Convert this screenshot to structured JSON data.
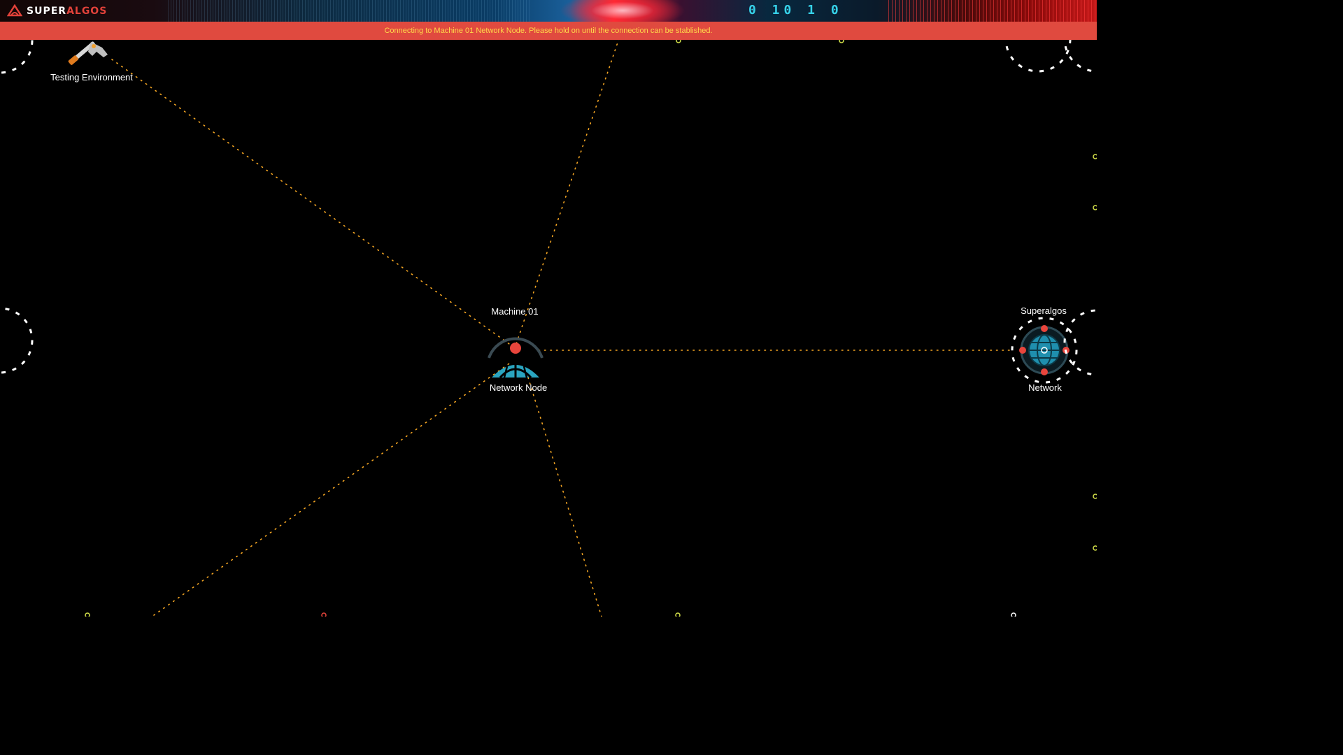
{
  "app": {
    "logo_text_primary": "SUPER",
    "logo_text_secondary": "ALGOS",
    "header_bits": "0 10 1 0"
  },
  "banner": {
    "message": "Connecting to Machine 01 Network Node. Please hold on until the connection can be stablished."
  },
  "nodes": {
    "testing_environment": "Testing Environment",
    "machine": "Machine 01",
    "network_node": "Network Node",
    "superalgos": "Superalgos",
    "network": "Network"
  },
  "colors": {
    "banner_bg": "#e04a3f",
    "banner_text": "#ffd84a",
    "connection_dots": "#f5a623",
    "node_accent": "#2aa5c0",
    "node_hotspot": "#e8453c"
  }
}
